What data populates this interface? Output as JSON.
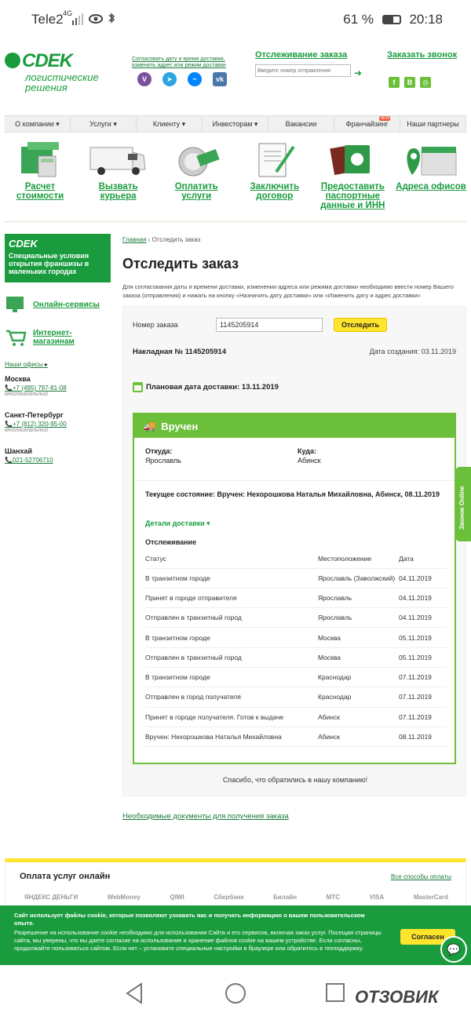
{
  "status_bar": {
    "carrier": "Tele2",
    "network": "4G",
    "battery": "61 %",
    "time": "20:18"
  },
  "header": {
    "logo": "СDEK",
    "logo_sub": "логистические решения",
    "info_line1": "Согласовать дату и время доставки,",
    "info_line2": "изменить адрес или режим доставки",
    "tracking_title": "Отслеживание заказа",
    "tracking_placeholder": "Введите номер отправления",
    "call_title": "Заказать звонок",
    "social_right": [
      "f",
      "B",
      "◎"
    ]
  },
  "nav": [
    {
      "label": "О компании ▾"
    },
    {
      "label": "Услуги ▾"
    },
    {
      "label": "Клиенту ▾"
    },
    {
      "label": "Инвесторам ▾"
    },
    {
      "label": "Вакансии"
    },
    {
      "label": "Франчайзинг",
      "badge": "NEW"
    },
    {
      "label": "Наши партнеры"
    }
  ],
  "services": [
    {
      "label": "Расчет стоимости",
      "icon": "calculator-box-icon"
    },
    {
      "label": "Вызвать курьера",
      "icon": "van-icon"
    },
    {
      "label": "Оплатить услуги",
      "icon": "payment-icon"
    },
    {
      "label": "Заключить договор",
      "icon": "contract-icon"
    },
    {
      "label": "Предоставить паспортные данные и ИНН",
      "icon": "passport-icon"
    },
    {
      "label": "Адреса офисов",
      "icon": "map-pin-icon"
    }
  ],
  "sidebar": {
    "promo_logo": "СDEK",
    "promo_text": "Специальные условия открытия франшизы в маленьких городах",
    "online": "Онлайн-сервисы",
    "shops": "Интернет-магазинам",
    "offices": "Наши офисы",
    "cities": [
      {
        "name": "Москва",
        "phone": "+7 (495) 797-81-08",
        "note": "многоканальный"
      },
      {
        "name": "Санкт-Петербург",
        "phone": "+7 (812) 320-95-00",
        "note": "многоканальный"
      },
      {
        "name": "Шанхай",
        "phone": "021-52706710",
        "note": ""
      }
    ]
  },
  "main": {
    "crumb_home": "Главная",
    "crumb_current": "Отследить заказ",
    "title": "Отследить заказ",
    "intro": "Для согласования даты и времени доставки, изменении адреса или режима доставки необходимо ввести номер Вашего заказа (отправления) и нажать на кнопку «Назначить дату доставки» или «Изменить дату и адрес доставки»",
    "order_label": "Номер заказа",
    "order_value": "1145205914",
    "track_btn": "Отследить",
    "waybill": "Накладная № 1145205914",
    "created": "Дата создания: 03.11.2019",
    "planned": "Плановая дата доставки: 13.11.2019",
    "status_title": "Вручен",
    "from_label": "Откуда:",
    "from_value": "Ярославль",
    "to_label": "Куда:",
    "to_value": "Абинск",
    "current_state": "Текущее состояние: Вручен: Нехорошкова Наталья Михайловна, Абинск, 08.11.2019",
    "details": "Детали доставки ▾",
    "tracking_heading": "Отслеживание",
    "columns": [
      "Статус",
      "Местоположение",
      "Дата"
    ],
    "rows": [
      [
        "В транзитном городе",
        "Ярославль (Заволжский)",
        "04.11.2019"
      ],
      [
        "Принят в городе отправителя",
        "Ярославль",
        "04.11.2019"
      ],
      [
        "Отправлен в транзитный город",
        "Ярославль",
        "04.11.2019"
      ],
      [
        "В транзитном городе",
        "Москва",
        "05.11.2019"
      ],
      [
        "Отправлен в транзитный город",
        "Москва",
        "05.11.2019"
      ],
      [
        "В транзитном городе",
        "Краснодар",
        "07.11.2019"
      ],
      [
        "Отправлен в город получателя",
        "Краснодар",
        "07.11.2019"
      ],
      [
        "Принят в городе получателя. Готов к выдаче",
        "Абинск",
        "07.11.2019"
      ],
      [
        "Вручен: Нехорошкова Наталья Михайловна",
        "Абинск",
        "08.11.2019"
      ]
    ],
    "thanks": "Спасибо, что обратились в нашу компанию!",
    "docs_link": "Необходимые документы для получения заказа"
  },
  "payment": {
    "title": "Оплата услуг онлайн",
    "all": "Все способы оплаты",
    "logos": [
      "ЯНДЕКС ДЕНЬГИ",
      "WebMoney",
      "QIWI",
      "Сбербанк",
      "Билайн",
      "МТС",
      "VISA",
      "MasterCard"
    ]
  },
  "cookie": {
    "title": "Сайт использует файлы cookie, которые позволяют узнавать вас и получать информацию о вашем пользовательском опыте.",
    "text": "Разрешение на использование cookie необходимо для использования Сайта и его сервисов, включая заказ услуг. Посещая страницы сайта, мы уверены, что вы даете согласие на использование и хранение файлов cookie на вашем устройстве. Если согласны, продолжайте пользоваться сайтом. Если нет – установите специальные настройки в браузере или обратитесь в техподдержку.",
    "agree": "Согласен"
  },
  "side_tab": "Звонок Online",
  "watermark": "ОТЗОВИК",
  "colors": {
    "brand_green": "#1a9c3e",
    "light_green": "#6cbf3a",
    "yellow": "#ffe42c"
  }
}
